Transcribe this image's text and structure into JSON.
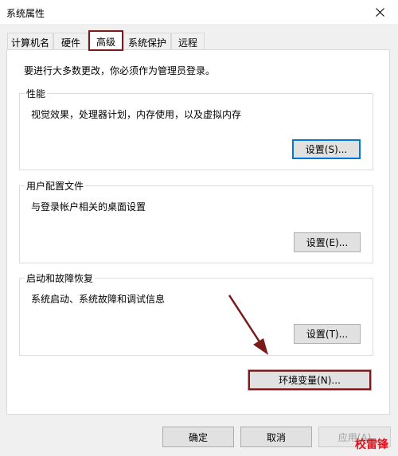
{
  "window": {
    "title": "系统属性",
    "close_icon": "close-icon"
  },
  "tabs": [
    {
      "label": "计算机名"
    },
    {
      "label": "硬件"
    },
    {
      "label": "高级"
    },
    {
      "label": "系统保护"
    },
    {
      "label": "远程"
    }
  ],
  "active_tab": "高级",
  "note": "要进行大多数更改，你必须作为管理员登录。",
  "groups": {
    "performance": {
      "label": "性能",
      "description": "视觉效果，处理器计划，内存使用，以及虚拟内存",
      "button": "设置(S)..."
    },
    "profiles": {
      "label": "用户配置文件",
      "description": "与登录帐户相关的桌面设置",
      "button": "设置(E)..."
    },
    "startup": {
      "label": "启动和故障恢复",
      "description": "系统启动、系统故障和调试信息",
      "button": "设置(T)..."
    }
  },
  "env_button": "环境变量(N)...",
  "footer": {
    "ok": "确定",
    "cancel": "取消",
    "apply": "应用(A)"
  },
  "watermark": "校雷锋",
  "colors": {
    "highlight": "#7b1a1a",
    "focus": "#0078d7",
    "watermark": "#e0141e"
  }
}
